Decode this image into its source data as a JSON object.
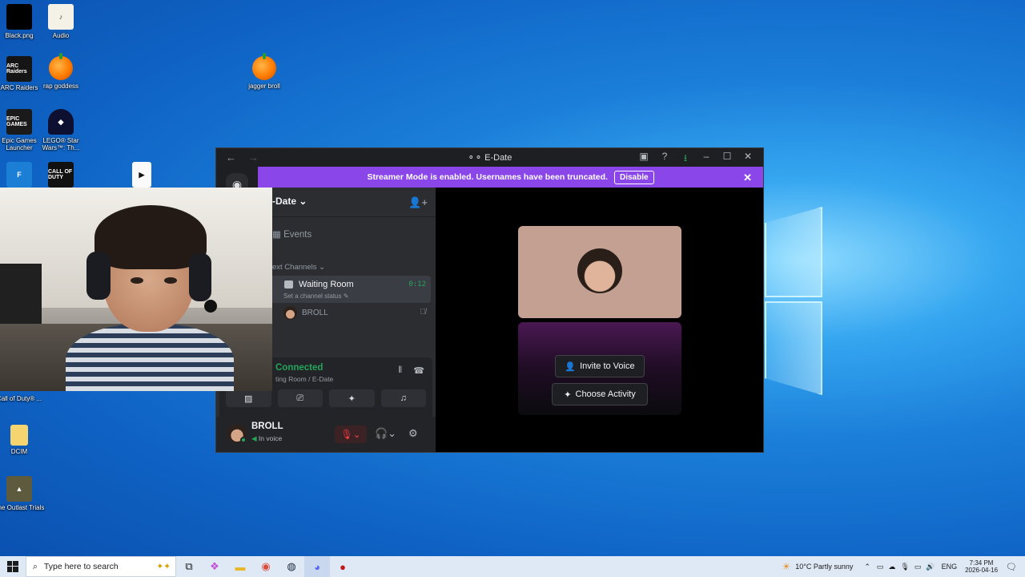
{
  "desktop": {
    "icons": [
      {
        "label": "Black.png"
      },
      {
        "label": "Audio"
      },
      {
        "label": "ARC Raiders"
      },
      {
        "label": "rap goddess"
      },
      {
        "label": "jagger broll"
      },
      {
        "label": "Epic Games Launcher"
      },
      {
        "label": "LEGO® Star Wars™: Th..."
      },
      {
        "label": "Call of Duty® ..."
      },
      {
        "label": "DCIM"
      },
      {
        "label": "The Outlast Trials"
      }
    ],
    "icon_art": {
      "arc": "ARC Raiders",
      "epic": "EPIC GAMES",
      "cod": "CALL OF DUTY"
    }
  },
  "discord": {
    "window_title": "E-Date",
    "banner": {
      "text": "Streamer Mode is enabled. Usernames have been truncated.",
      "disable_label": "Disable"
    },
    "server_name": "-Date",
    "events_label": "Events",
    "category_label": "ext Channels",
    "voice_channel": {
      "name": "Waiting Room",
      "timer": "0:12",
      "status": "Set a channel status"
    },
    "member": {
      "name": "BROLL"
    },
    "rtc": {
      "status": "Connected",
      "location": "ting Room / E-Date"
    },
    "user": {
      "name": "BROLL",
      "status": "In voice"
    },
    "stage": {
      "invite_label": "Invite to Voice",
      "activity_label": "Choose Activity"
    }
  },
  "taskbar": {
    "search_placeholder": "Type here to search",
    "weather": "10°C  Partly sunny",
    "language": "ENG",
    "time": "7:34 PM",
    "date": "2026-04-16"
  }
}
